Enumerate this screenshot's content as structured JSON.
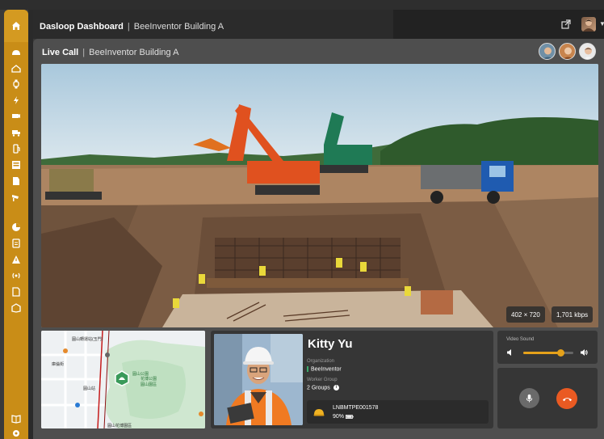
{
  "header": {
    "app_title": "Dasloop Dashboard",
    "separator": "|",
    "site": "BeeInventor Building A"
  },
  "panel": {
    "title": "Live Call",
    "separator": "|",
    "site": "BeeInventor Building A"
  },
  "video": {
    "resolution": "402 × 720",
    "bitrate": "1,701 kbps"
  },
  "map": {
    "labels": [
      "圓山轉運站(玉門)",
      "庫倫街",
      "圓山公園",
      "花博公園",
      "圓山園區",
      "圓山站",
      "圓山花博園區"
    ]
  },
  "worker": {
    "name": "Kitty Yu",
    "organization_label": "Organization",
    "organization": "BeeInventor",
    "group_label": "Worker Group",
    "groups": "2 Groups",
    "device_id": "LNBMTPE001578",
    "battery": "90%"
  },
  "audio": {
    "label": "Video Sound",
    "volume": 0.75
  },
  "colors": {
    "accent": "#c98d17",
    "end_call": "#ea5a22",
    "slider": "#e5a11a"
  },
  "icons": [
    "home-icon",
    "helmet-icon",
    "worker-location-icon",
    "watch-icon",
    "power-icon",
    "camera-icon",
    "truck-icon",
    "gas-icon",
    "panel-icon",
    "tag-icon",
    "cctv-icon",
    "pie-chart-icon",
    "report-icon",
    "warning-icon",
    "broadcast-icon",
    "invoice-icon",
    "box-icon",
    "book-icon",
    "settings-icon",
    "external-link-icon",
    "microphone-icon",
    "end-call-icon",
    "volume-low-icon",
    "volume-high-icon",
    "info-icon",
    "helmet-device-icon",
    "battery-icon"
  ]
}
